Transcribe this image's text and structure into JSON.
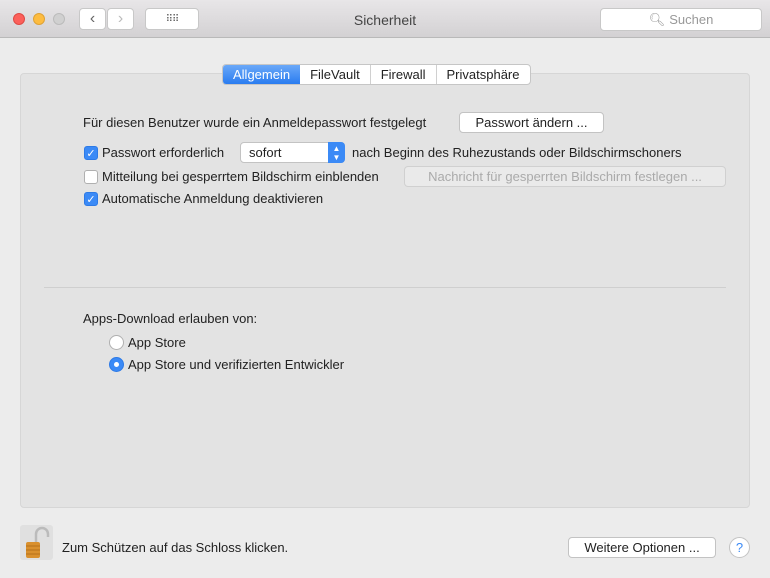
{
  "window": {
    "title": "Sicherheit",
    "search_placeholder": "Suchen"
  },
  "tabs": [
    {
      "label": "Allgemein",
      "active": true
    },
    {
      "label": "FileVault"
    },
    {
      "label": "Firewall"
    },
    {
      "label": "Privatsphäre"
    }
  ],
  "general": {
    "password_text": "Für diesen Benutzer wurde ein Anmeldepasswort festgelegt",
    "change_password": "Passwort ändern ...",
    "require_password": {
      "label": "Passwort erforderlich",
      "checked": true,
      "select_value": "sofort",
      "suffix": "nach Beginn des Ruhezustands oder Bildschirmschoners"
    },
    "lock_message": {
      "label": "Mitteilung bei gesperrtem Bildschirm einblenden",
      "checked": false,
      "button": "Nachricht für gesperrten Bildschirm festlegen ..."
    },
    "auto_login": {
      "label": "Automatische Anmeldung deaktivieren",
      "checked": true
    }
  },
  "downloads": {
    "heading": "Apps-Download erlauben von:",
    "options": [
      {
        "label": "App Store",
        "selected": false
      },
      {
        "label": "App Store und verifizierten Entwickler",
        "selected": true
      }
    ]
  },
  "footer": {
    "lock_text": "Zum Schützen auf das Schloss klicken.",
    "advanced": "Weitere Optionen ...",
    "help": "?"
  }
}
